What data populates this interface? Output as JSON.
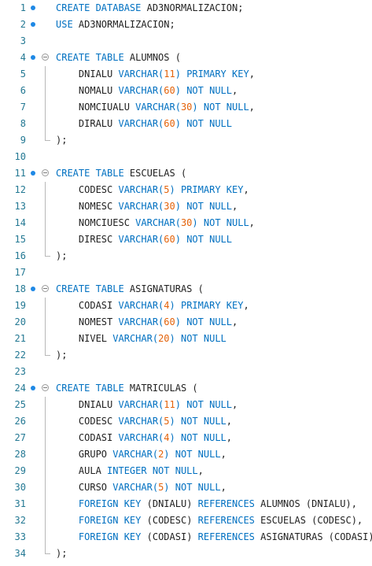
{
  "editor": {
    "lines": [
      {
        "n": "1",
        "mark": true,
        "fold": false,
        "guide": "",
        "indent": "",
        "tokens": [
          [
            "k",
            "CREATE DATABASE"
          ],
          [
            "p",
            " AD3NORMALIZACION;"
          ]
        ]
      },
      {
        "n": "2",
        "mark": true,
        "fold": false,
        "guide": "",
        "indent": "",
        "tokens": [
          [
            "k",
            "USE"
          ],
          [
            "p",
            " AD3NORMALIZACION;"
          ]
        ]
      },
      {
        "n": "3",
        "mark": false,
        "fold": false,
        "guide": "",
        "indent": "",
        "tokens": []
      },
      {
        "n": "4",
        "mark": true,
        "fold": true,
        "guide": "",
        "indent": "",
        "tokens": [
          [
            "k",
            "CREATE TABLE"
          ],
          [
            "p",
            " ALUMNOS ("
          ]
        ]
      },
      {
        "n": "5",
        "mark": false,
        "fold": false,
        "guide": "mid",
        "indent": "    ",
        "tokens": [
          [
            "p",
            "DNIALU "
          ],
          [
            "k",
            "VARCHAR("
          ],
          [
            "n",
            "11"
          ],
          [
            "k",
            ")"
          ],
          [
            "p",
            " "
          ],
          [
            "k",
            "PRIMARY KEY"
          ],
          [
            "p",
            ","
          ]
        ]
      },
      {
        "n": "6",
        "mark": false,
        "fold": false,
        "guide": "mid",
        "indent": "    ",
        "tokens": [
          [
            "p",
            "NOMALU "
          ],
          [
            "k",
            "VARCHAR("
          ],
          [
            "n",
            "60"
          ],
          [
            "k",
            ")"
          ],
          [
            "p",
            " "
          ],
          [
            "k",
            "NOT NULL"
          ],
          [
            "p",
            ","
          ]
        ]
      },
      {
        "n": "7",
        "mark": false,
        "fold": false,
        "guide": "mid",
        "indent": "    ",
        "tokens": [
          [
            "p",
            "NOMCIUALU "
          ],
          [
            "k",
            "VARCHAR("
          ],
          [
            "n",
            "30"
          ],
          [
            "k",
            ")"
          ],
          [
            "p",
            " "
          ],
          [
            "k",
            "NOT NULL"
          ],
          [
            "p",
            ","
          ]
        ]
      },
      {
        "n": "8",
        "mark": false,
        "fold": false,
        "guide": "mid",
        "indent": "    ",
        "tokens": [
          [
            "p",
            "DIRALU "
          ],
          [
            "k",
            "VARCHAR("
          ],
          [
            "n",
            "60"
          ],
          [
            "k",
            ")"
          ],
          [
            "p",
            " "
          ],
          [
            "k",
            "NOT NULL"
          ]
        ]
      },
      {
        "n": "9",
        "mark": false,
        "fold": false,
        "guide": "end",
        "indent": "",
        "tokens": [
          [
            "p",
            ");"
          ]
        ]
      },
      {
        "n": "10",
        "mark": false,
        "fold": false,
        "guide": "",
        "indent": "",
        "tokens": []
      },
      {
        "n": "11",
        "mark": true,
        "fold": true,
        "guide": "",
        "indent": "",
        "tokens": [
          [
            "k",
            "CREATE TABLE"
          ],
          [
            "p",
            " ESCUELAS ("
          ]
        ]
      },
      {
        "n": "12",
        "mark": false,
        "fold": false,
        "guide": "mid",
        "indent": "    ",
        "tokens": [
          [
            "p",
            "CODESC "
          ],
          [
            "k",
            "VARCHAR("
          ],
          [
            "n",
            "5"
          ],
          [
            "k",
            ")"
          ],
          [
            "p",
            " "
          ],
          [
            "k",
            "PRIMARY KEY"
          ],
          [
            "p",
            ","
          ]
        ]
      },
      {
        "n": "13",
        "mark": false,
        "fold": false,
        "guide": "mid",
        "indent": "    ",
        "tokens": [
          [
            "p",
            "NOMESC "
          ],
          [
            "k",
            "VARCHAR("
          ],
          [
            "n",
            "30"
          ],
          [
            "k",
            ")"
          ],
          [
            "p",
            " "
          ],
          [
            "k",
            "NOT NULL"
          ],
          [
            "p",
            ","
          ]
        ]
      },
      {
        "n": "14",
        "mark": false,
        "fold": false,
        "guide": "mid",
        "indent": "    ",
        "tokens": [
          [
            "p",
            "NOMCIUESC "
          ],
          [
            "k",
            "VARCHAR("
          ],
          [
            "n",
            "30"
          ],
          [
            "k",
            ")"
          ],
          [
            "p",
            " "
          ],
          [
            "k",
            "NOT NULL"
          ],
          [
            "p",
            ","
          ]
        ]
      },
      {
        "n": "15",
        "mark": false,
        "fold": false,
        "guide": "mid",
        "indent": "    ",
        "tokens": [
          [
            "p",
            "DIRESC "
          ],
          [
            "k",
            "VARCHAR("
          ],
          [
            "n",
            "60"
          ],
          [
            "k",
            ")"
          ],
          [
            "p",
            " "
          ],
          [
            "k",
            "NOT NULL"
          ]
        ]
      },
      {
        "n": "16",
        "mark": false,
        "fold": false,
        "guide": "end",
        "indent": "",
        "tokens": [
          [
            "p",
            ");"
          ]
        ]
      },
      {
        "n": "17",
        "mark": false,
        "fold": false,
        "guide": "",
        "indent": "",
        "tokens": []
      },
      {
        "n": "18",
        "mark": true,
        "fold": true,
        "guide": "",
        "indent": "",
        "tokens": [
          [
            "k",
            "CREATE TABLE"
          ],
          [
            "p",
            " ASIGNATURAS ("
          ]
        ]
      },
      {
        "n": "19",
        "mark": false,
        "fold": false,
        "guide": "mid",
        "indent": "    ",
        "tokens": [
          [
            "p",
            "CODASI "
          ],
          [
            "k",
            "VARCHAR("
          ],
          [
            "n",
            "4"
          ],
          [
            "k",
            ")"
          ],
          [
            "p",
            " "
          ],
          [
            "k",
            "PRIMARY KEY"
          ],
          [
            "p",
            ","
          ]
        ]
      },
      {
        "n": "20",
        "mark": false,
        "fold": false,
        "guide": "mid",
        "indent": "    ",
        "tokens": [
          [
            "p",
            "NOMEST "
          ],
          [
            "k",
            "VARCHAR("
          ],
          [
            "n",
            "60"
          ],
          [
            "k",
            ")"
          ],
          [
            "p",
            " "
          ],
          [
            "k",
            "NOT NULL"
          ],
          [
            "p",
            ","
          ]
        ]
      },
      {
        "n": "21",
        "mark": false,
        "fold": false,
        "guide": "mid",
        "indent": "    ",
        "tokens": [
          [
            "p",
            "NIVEL "
          ],
          [
            "k",
            "VARCHAR("
          ],
          [
            "n",
            "20"
          ],
          [
            "k",
            ")"
          ],
          [
            "p",
            " "
          ],
          [
            "k",
            "NOT NULL"
          ]
        ]
      },
      {
        "n": "22",
        "mark": false,
        "fold": false,
        "guide": "end",
        "indent": "",
        "tokens": [
          [
            "p",
            ");"
          ]
        ]
      },
      {
        "n": "23",
        "mark": false,
        "fold": false,
        "guide": "",
        "indent": "",
        "tokens": []
      },
      {
        "n": "24",
        "mark": true,
        "fold": true,
        "guide": "",
        "indent": "",
        "tokens": [
          [
            "k",
            "CREATE TABLE"
          ],
          [
            "p",
            " MATRICULAS ("
          ]
        ]
      },
      {
        "n": "25",
        "mark": false,
        "fold": false,
        "guide": "mid",
        "indent": "    ",
        "tokens": [
          [
            "p",
            "DNIALU "
          ],
          [
            "k",
            "VARCHAR("
          ],
          [
            "n",
            "11"
          ],
          [
            "k",
            ")"
          ],
          [
            "p",
            " "
          ],
          [
            "k",
            "NOT NULL"
          ],
          [
            "p",
            ","
          ]
        ]
      },
      {
        "n": "26",
        "mark": false,
        "fold": false,
        "guide": "mid",
        "indent": "    ",
        "tokens": [
          [
            "p",
            "CODESC "
          ],
          [
            "k",
            "VARCHAR("
          ],
          [
            "n",
            "5"
          ],
          [
            "k",
            ")"
          ],
          [
            "p",
            " "
          ],
          [
            "k",
            "NOT NULL"
          ],
          [
            "p",
            ","
          ]
        ]
      },
      {
        "n": "27",
        "mark": false,
        "fold": false,
        "guide": "mid",
        "indent": "    ",
        "tokens": [
          [
            "p",
            "CODASI "
          ],
          [
            "k",
            "VARCHAR("
          ],
          [
            "n",
            "4"
          ],
          [
            "k",
            ")"
          ],
          [
            "p",
            " "
          ],
          [
            "k",
            "NOT NULL"
          ],
          [
            "p",
            ","
          ]
        ]
      },
      {
        "n": "28",
        "mark": false,
        "fold": false,
        "guide": "mid",
        "indent": "    ",
        "tokens": [
          [
            "p",
            "GRUPO "
          ],
          [
            "k",
            "VARCHAR("
          ],
          [
            "n",
            "2"
          ],
          [
            "k",
            ")"
          ],
          [
            "p",
            " "
          ],
          [
            "k",
            "NOT NULL"
          ],
          [
            "p",
            ","
          ]
        ]
      },
      {
        "n": "29",
        "mark": false,
        "fold": false,
        "guide": "mid",
        "indent": "    ",
        "tokens": [
          [
            "p",
            "AULA "
          ],
          [
            "k",
            "INTEGER NOT NULL"
          ],
          [
            "p",
            ","
          ]
        ]
      },
      {
        "n": "30",
        "mark": false,
        "fold": false,
        "guide": "mid",
        "indent": "    ",
        "tokens": [
          [
            "p",
            "CURSO "
          ],
          [
            "k",
            "VARCHAR("
          ],
          [
            "n",
            "5"
          ],
          [
            "k",
            ")"
          ],
          [
            "p",
            " "
          ],
          [
            "k",
            "NOT NULL"
          ],
          [
            "p",
            ","
          ]
        ]
      },
      {
        "n": "31",
        "mark": false,
        "fold": false,
        "guide": "mid",
        "indent": "    ",
        "tokens": [
          [
            "k",
            "FOREIGN KEY"
          ],
          [
            "p",
            " (DNIALU) "
          ],
          [
            "k",
            "REFERENCES"
          ],
          [
            "p",
            " ALUMNOS (DNIALU),"
          ]
        ]
      },
      {
        "n": "32",
        "mark": false,
        "fold": false,
        "guide": "mid",
        "indent": "    ",
        "tokens": [
          [
            "k",
            "FOREIGN KEY"
          ],
          [
            "p",
            " (CODESC) "
          ],
          [
            "k",
            "REFERENCES"
          ],
          [
            "p",
            " ESCUELAS (CODESC),"
          ]
        ]
      },
      {
        "n": "33",
        "mark": false,
        "fold": false,
        "guide": "mid",
        "indent": "    ",
        "tokens": [
          [
            "k",
            "FOREIGN KEY"
          ],
          [
            "p",
            " (CODASI) "
          ],
          [
            "k",
            "REFERENCES"
          ],
          [
            "p",
            " ASIGNATURAS (CODASI)"
          ]
        ]
      },
      {
        "n": "34",
        "mark": false,
        "fold": false,
        "guide": "end",
        "indent": "",
        "tokens": [
          [
            "p",
            ");"
          ]
        ]
      }
    ]
  },
  "colors": {
    "keyword": "#0070c1",
    "number": "#e36209",
    "plain": "#1f1f1f",
    "line_number": "#237893",
    "breakpoint": "#1e88e5"
  }
}
